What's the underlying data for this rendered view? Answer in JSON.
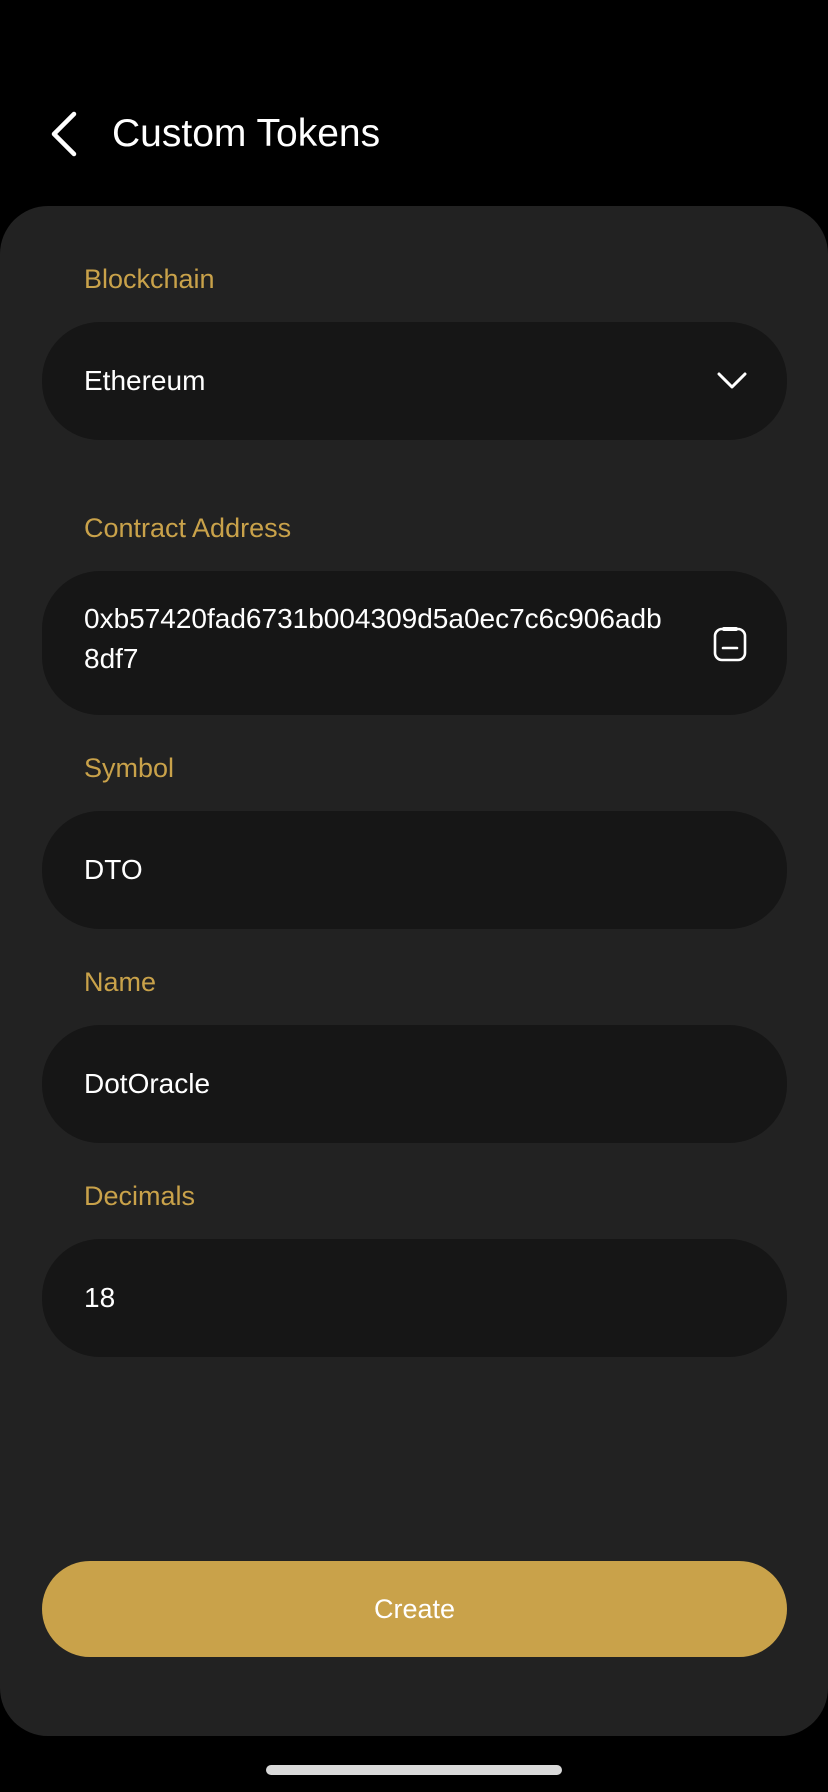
{
  "header": {
    "title": "Custom Tokens",
    "back_icon": "chevron-left-icon"
  },
  "form": {
    "blockchain": {
      "label": "Blockchain",
      "value": "Ethereum",
      "icon": "chevron-down-icon"
    },
    "contract_address": {
      "label": "Contract Address",
      "value": "0xb57420fad6731b004309d5a0ec7c6c906adb8df7",
      "icon": "paste-icon"
    },
    "symbol": {
      "label": "Symbol",
      "value": "DTO"
    },
    "name": {
      "label": "Name",
      "value": "DotOracle"
    },
    "decimals": {
      "label": "Decimals",
      "value": "18"
    }
  },
  "actions": {
    "create_label": "Create"
  },
  "colors": {
    "background": "#000000",
    "panel": "#222222",
    "field": "#161616",
    "accent": "#c9a24a",
    "text": "#ffffff"
  }
}
